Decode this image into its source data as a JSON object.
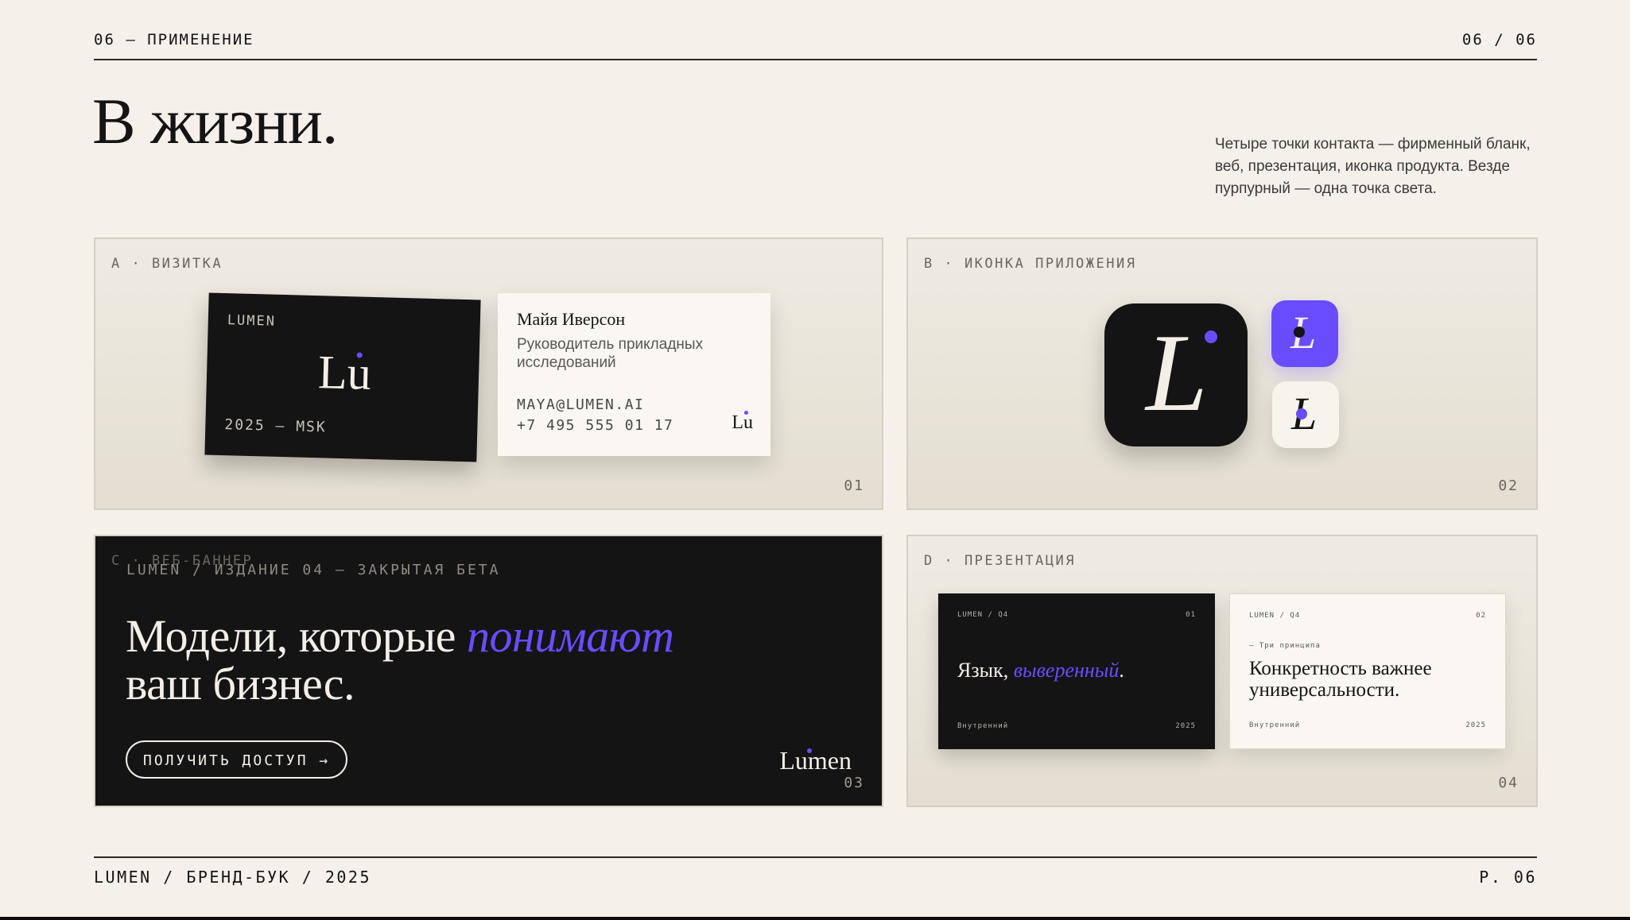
{
  "header": {
    "section_label": "06 — ПРИМЕНЕНИЕ",
    "page_counter": "06 / 06",
    "title": "В жизни.",
    "intro": "Четыре точки контакта — фирменный бланк, веб, презентация, иконка продукта. Везде пурпурный — одна точка света."
  },
  "panels": {
    "a": {
      "label": "A · ВИЗИТКА",
      "number": "01",
      "dark_card": {
        "brand": "LUMEN",
        "mark": "Lu",
        "footer": "2025 — MSK"
      },
      "light_card": {
        "name": "Майя Иверсон",
        "role": "Руководитель прикладных исследований",
        "email": "MAYA@LUMEN.AI",
        "phone": "+7 495 555 01 17",
        "mark": "Lu"
      }
    },
    "b": {
      "label": "B · ИКОНКА ПРИЛОЖЕНИЯ",
      "number": "02",
      "icon_letter": "L"
    },
    "c": {
      "label": "C · ВЕБ-БАННЕР",
      "number": "03",
      "eyebrow": "LUMEN / ИЗДАНИЕ 04 — ЗАКРЫТАЯ БЕТА",
      "headline_start": "Модели, которые ",
      "headline_accent": "понимают",
      "headline_end": "ваш бизнес.",
      "cta": "ПОЛУЧИТЬ ДОСТУП →",
      "logo": "Lumen"
    },
    "d": {
      "label": "D · ПРЕЗЕНТАЦИЯ",
      "number": "04",
      "slide1": {
        "top": "LUMEN / Q4",
        "num": "01",
        "headline_start": "Язык, ",
        "headline_accent": "выверенный",
        "headline_end": ".",
        "footer": "Внутренний",
        "year": "2025"
      },
      "slide2": {
        "top": "LUMEN / Q4",
        "num": "02",
        "kicker": "— Три принципа",
        "headline": "Конкретность важнее универсальности.",
        "footer": "Внутренний",
        "year": "2025"
      }
    }
  },
  "footer": {
    "left": "LUMEN / БРЕНД-БУК / 2025",
    "right": "P. 06"
  },
  "colors": {
    "accent": "#6a4cff",
    "ink": "#141414",
    "paper": "#f5f0ea"
  }
}
